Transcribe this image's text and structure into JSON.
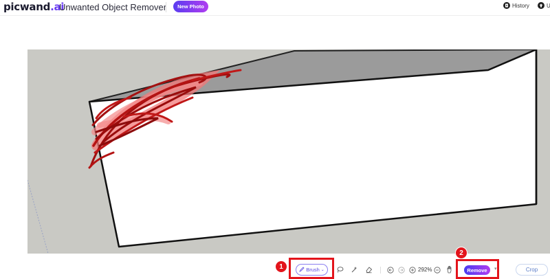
{
  "header": {
    "logo_main": "picwand",
    "logo_accent": ".ai",
    "app_title": "Unwanted Object Remover",
    "new_photo_label": "New Photo",
    "history_label": "History",
    "upload_label": "U"
  },
  "toolbar": {
    "brush_label": "Brush",
    "zoom_value": "292%",
    "remove_label": "Remove",
    "crop_label": "Crop",
    "icons": [
      "lasso-icon",
      "magic-select-icon",
      "eraser-icon",
      "undo-icon",
      "redo-icon",
      "zoom-in-icon",
      "zoom-out-icon",
      "hand-icon"
    ]
  },
  "annotations": {
    "badge_1": "1",
    "badge_2": "2",
    "highlight_color": "#e3141b"
  },
  "colors": {
    "accent": "#6a3df2",
    "canvas_bg": "#c9c9c4",
    "brush_stroke": "#d01010"
  }
}
